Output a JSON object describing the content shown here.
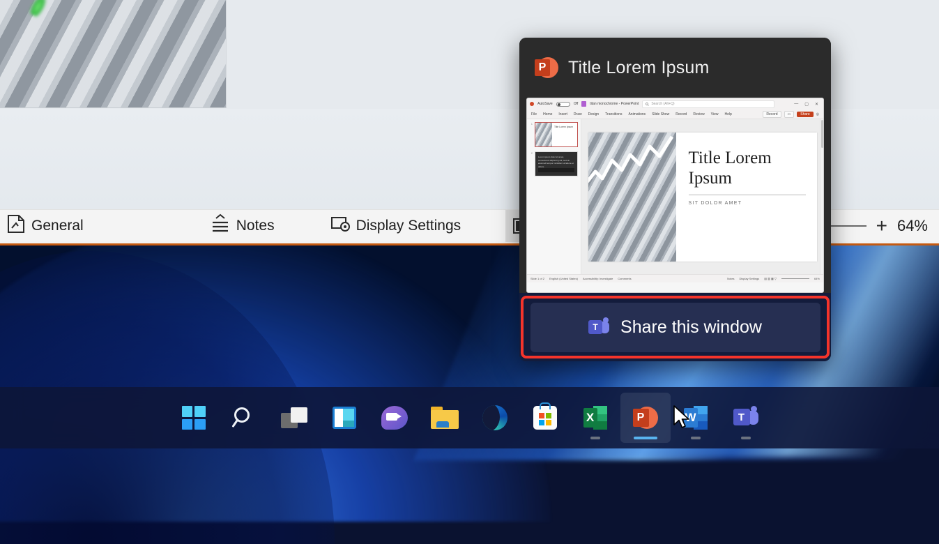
{
  "background_app": {
    "status_bar": {
      "general_label": "General",
      "general_icon": "theme-page-icon",
      "notes_label": "Notes",
      "notes_icon": "notes-icon",
      "display_settings_label": "Display Settings",
      "display_settings_icon": "display-settings-icon",
      "view_normal_icon": "normal-view-icon",
      "zoom_plus": "+",
      "zoom_percent": "64%"
    }
  },
  "preview_popup": {
    "app_icon": "powerpoint-icon",
    "app_icon_letter": "P",
    "title": "Title Lorem Ipsum",
    "share_button": {
      "label": "Share this window",
      "icon": "teams-icon",
      "icon_letter": "T",
      "highlight_color": "#f5342b",
      "background": "#262f52"
    },
    "window_preview": {
      "titlebar": {
        "autosave_label": "AutoSave",
        "autosave_state": "Off",
        "document_title": "titan monochrome - PowerPoint",
        "search_placeholder": "Search (Alt+Q)",
        "minimize_icon": "minimize-icon",
        "maximize_icon": "maximize-icon",
        "close_icon": "close-icon"
      },
      "ribbon_tabs": [
        "File",
        "Home",
        "Insert",
        "Draw",
        "Design",
        "Transitions",
        "Animations",
        "Slide Show",
        "Record",
        "Review",
        "View",
        "Help"
      ],
      "ribbon_right": {
        "record_label": "Record",
        "comments_icon": "comments-icon",
        "share_label": "Share",
        "help_icon": "help-circle-icon"
      },
      "slides": [
        {
          "number": "1",
          "title": "Title Lorem Ipsum",
          "subtitle": "SIT DOLOR AMET",
          "selected": true
        },
        {
          "number": "2",
          "body": "Lorem ipsum dolor sit amet, consectetur adipiscing elit, sed do eiusmod tempor incididunt ut labore et dolore.",
          "selected": false
        }
      ],
      "current_slide": {
        "title": "Title Lorem Ipsum",
        "subtitle": "SIT DOLOR AMET",
        "image": "stairs-photo"
      },
      "status_bar": {
        "slide_count": "Slide 1 of 2",
        "language": "English (United States)",
        "accessibility": "Accessibility: Investigate",
        "comments": "Comments",
        "notes": "Notes",
        "display_settings": "Display Settings",
        "zoom_percent": "64%"
      }
    }
  },
  "taskbar": {
    "items": [
      {
        "name": "start",
        "label": "Start",
        "state": "idle"
      },
      {
        "name": "search",
        "label": "Search",
        "state": "idle"
      },
      {
        "name": "task-view",
        "label": "Task View",
        "state": "idle"
      },
      {
        "name": "widgets",
        "label": "Widgets",
        "state": "idle"
      },
      {
        "name": "chat",
        "label": "Chat",
        "state": "idle"
      },
      {
        "name": "file-explorer",
        "label": "File Explorer",
        "state": "idle"
      },
      {
        "name": "edge",
        "label": "Microsoft Edge",
        "state": "idle"
      },
      {
        "name": "store",
        "label": "Microsoft Store",
        "state": "idle"
      },
      {
        "name": "excel",
        "label": "Excel",
        "state": "running"
      },
      {
        "name": "powerpoint",
        "label": "PowerPoint",
        "state": "active",
        "letter": "P"
      },
      {
        "name": "word",
        "label": "Word",
        "state": "running",
        "letter": "W"
      },
      {
        "name": "teams",
        "label": "Microsoft Teams",
        "state": "running",
        "letter": "T"
      }
    ]
  },
  "colors": {
    "accent_red": "#f5342b",
    "powerpoint_orange": "#ed6c47",
    "teams_purple": "#5059c9",
    "popup_dark": "#2b2b2b",
    "taskbar": "#0e1638"
  }
}
